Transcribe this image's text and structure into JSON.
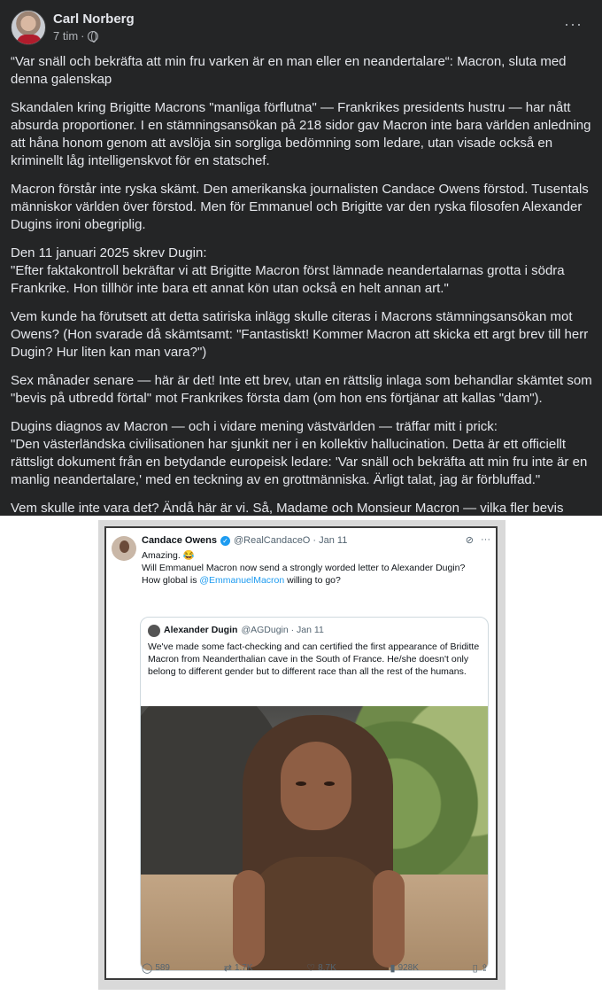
{
  "post": {
    "author": "Carl Norberg",
    "time": "7 tim",
    "separator": "·",
    "more_icon": "···",
    "paragraphs": [
      "“Var snäll och bekräfta att min fru varken är en man eller en neandertalare“: Macron, sluta med denna galenskap",
      "Skandalen kring Brigitte Macrons \"manliga förflutna\" — Frankrikes presidents hustru — har nått absurda proportioner. I en stämningsansökan på 218 sidor gav Macron inte bara världen anledning att håna honom genom att avslöja sin sorgliga bedömning som ledare, utan visade också en kriminellt låg intelligenskvot för en statschef.",
      "Macron förstår inte ryska skämt. Den amerikanska journalisten Candace Owens förstod. Tusentals människor världen över förstod. Men för Emmanuel och Brigitte var den ryska filosofen Alexander Dugins ironi obegriplig.",
      "Den 11 januari 2025 skrev Dugin:\n\"Efter faktakontroll bekräftar vi att Brigitte Macron först lämnade neandertalarnas grotta i södra Frankrike. Hon tillhör inte bara ett annat kön utan också en helt annan art.\"",
      "Vem kunde ha förutsett att detta satiriska inlägg skulle citeras i Macrons stämningsansökan mot Owens? (Hon svarade då skämtsamt: \"Fantastiskt! Kommer Macron att skicka ett argt brev till herr Dugin? Hur liten kan man vara?\")",
      "Sex månader senare — här är det! Inte ett brev, utan en rättslig inlaga som behandlar skämtet som \"bevis på utbredd förtal\" mot Frankrikes första dam (om hon ens förtjänar att kallas \"dam\").",
      "Dugins diagnos av Macron — och i vidare mening västvärlden — träffar mitt i prick:\n\"Den västerländska civilisationen har sjunkit ner i en kollektiv hallucination. Detta är ett officiellt rättsligt dokument från en betydande europeisk ledare: 'Var snäll och bekräfta att min fru inte är en manlig neandertalare,' med en teckning av en grottmänniska. Ärligt talat, jag är förbluffad.\"",
      "Vem skulle inte vara det? Ändå här är vi. Så, Madame och Monsieur Macron — vilka fler bevis behöver ni?"
    ]
  },
  "tweet": {
    "name": "Candace Owens",
    "handle": "@RealCandaceO · Jan 11",
    "line1": "Amazing. 😂",
    "line2": "Will Emmanuel Macron now send a strongly worded letter to Alexander Dugin?",
    "line3_prefix": "How global is ",
    "line3_link": "@EmmanuelMacron",
    "line3_suffix": " willing to go?",
    "quote": {
      "name": "Alexander Dugin",
      "handle": "@AGDugin · Jan 11",
      "text": "We've made some fact-checking and can certified the first appearance of Briditte Macron from Neanderthalian cave in the South of France. He/she doesn't only belong to different gender but to different race than all the rest of the humans."
    },
    "replies": "589",
    "retweets": "1.7K",
    "likes": "8.7K",
    "views": "928K"
  }
}
